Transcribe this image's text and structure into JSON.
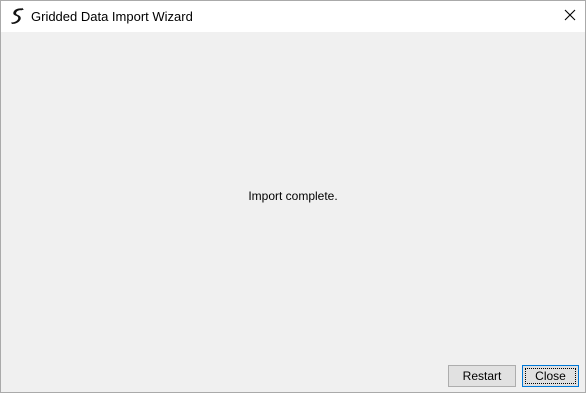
{
  "window": {
    "title": "Gridded Data Import Wizard",
    "app_icon": "app-logo-icon",
    "close_icon": "close-icon"
  },
  "main": {
    "message": "Import complete."
  },
  "footer": {
    "restart_label": "Restart",
    "close_label": "Close"
  },
  "colors": {
    "titlebar_bg": "#ffffff",
    "content_bg": "#f0f0f0",
    "button_bg": "#e1e1e1",
    "focus_border": "#0078d7"
  }
}
